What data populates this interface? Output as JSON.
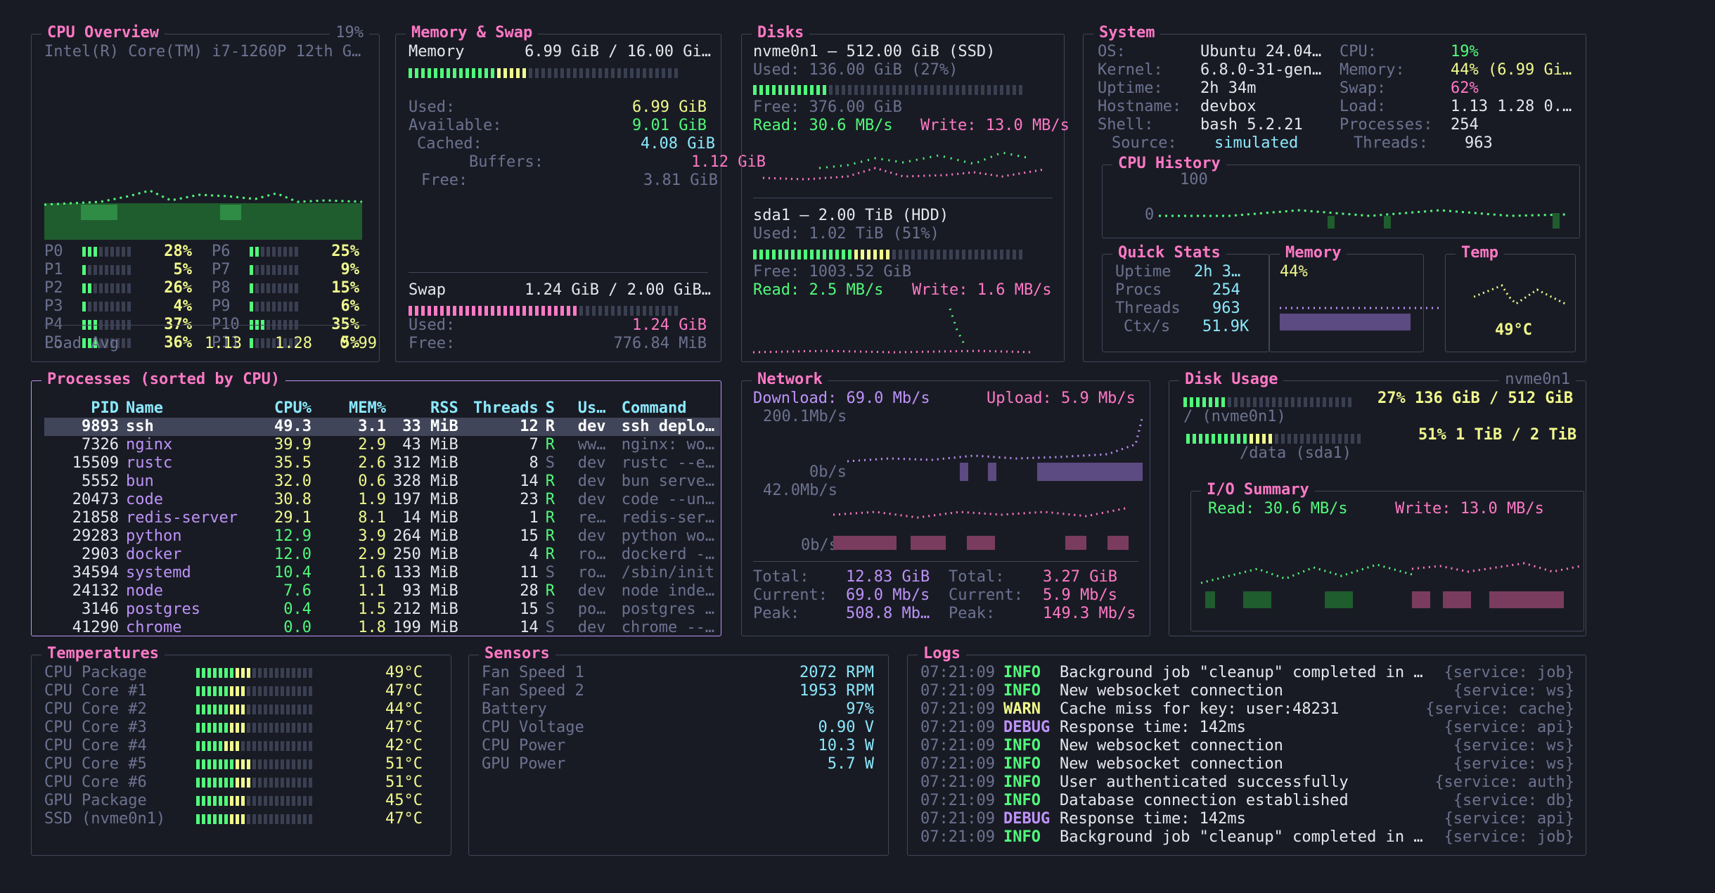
{
  "colors": {
    "bg": "#191b24",
    "border": "#414559",
    "title": "#ff79c6",
    "green": "#50fa7b",
    "pink": "#ff79c6",
    "yellow": "#f1fa8c",
    "cyan": "#8be9fd",
    "purple": "#bd93f9"
  },
  "cpu": {
    "title": "CPU Overview",
    "percent": "19%",
    "model": "Intel(R) Core(TM) i7-1260P 12th G…",
    "cores": [
      {
        "label": "P0",
        "value": "28%",
        "level": 0.28
      },
      {
        "label": "P6",
        "value": "25%",
        "level": 0.25
      },
      {
        "label": "P1",
        "value": "5%",
        "level": 0.05
      },
      {
        "label": "P7",
        "value": "9%",
        "level": 0.09
      },
      {
        "label": "P2",
        "value": "26%",
        "level": 0.26
      },
      {
        "label": "P8",
        "value": "15%",
        "level": 0.15
      },
      {
        "label": "P3",
        "value": "4%",
        "level": 0.04
      },
      {
        "label": "P9",
        "value": "6%",
        "level": 0.06
      },
      {
        "label": "P4",
        "value": "37%",
        "level": 0.37
      },
      {
        "label": "P10",
        "value": "35%",
        "level": 0.35
      },
      {
        "label": "P5",
        "value": "36%",
        "level": 0.36
      },
      {
        "label": "P11",
        "value": "5%",
        "level": 0.05
      }
    ],
    "load_label": "Load Avg",
    "load1": "1.13",
    "load5": "1.28",
    "load15": "0.99"
  },
  "memory": {
    "title": "Memory & Swap",
    "mem_label": "Memory",
    "mem_value": "6.99 GiB / 16.00 Gi…",
    "mem_level": 0.44,
    "used_label": "Used:",
    "used": "6.99 GiB",
    "avail_label": "Available:",
    "avail": "9.01 GiB",
    "cached_label": "Cached:",
    "cached": "4.08 GiB",
    "buffers_label": "Buffers:",
    "buffers": "1.12 GiB",
    "free_label": "Free:",
    "free": "3.81 GiB",
    "swap_label": "Swap",
    "swap_value": "1.24 GiB / 2.00 GiB…",
    "swap_level": 0.62,
    "swap_used_label": "Used:",
    "swap_used": "1.24 GiB",
    "swap_free_label": "Free:",
    "swap_free": "776.84 MiB"
  },
  "disks": {
    "title": "Disks",
    "d1": {
      "name": "nvme0n1 — 512.00 GiB (SSD)",
      "used": "Used: 136.00 GiB (27%)",
      "level": 0.27,
      "free": "Free: 376.00 GiB",
      "read": "Read: 30.6 MB/s",
      "write": "Write: 13.0 MB/s"
    },
    "d2": {
      "name": "sda1 — 2.00 TiB (HDD)",
      "used": "Used: 1.02 TiB (51%)",
      "level": 0.51,
      "free": "Free: 1003.52 GiB",
      "read": "Read: 2.5 MB/s",
      "write": "Write: 1.6 MB/s"
    }
  },
  "system": {
    "title": "System",
    "os_label": "OS:",
    "os": "Ubuntu 24.04…",
    "kernel_label": "Kernel:",
    "kernel": "6.8.0-31-gen…",
    "uptime_label": "Uptime:",
    "uptime": "2h 34m",
    "host_label": "Hostname:",
    "host": "devbox",
    "shell_label": "Shell:",
    "shell": "bash 5.2.21",
    "source_label": "Source:",
    "source": "simulated",
    "cpu_label": "CPU:",
    "cpu": "19%",
    "mem_label": "Memory:",
    "mem": "44% (6.99 Gi…",
    "swap_label": "Swap:",
    "swap": "62%",
    "load_label": "Load:",
    "load": "1.13 1.28 0.…",
    "procs_label": "Processes:",
    "procs": "254",
    "threads_label": "Threads:",
    "threads": "963",
    "history_title": "CPU History",
    "hist_max": "100",
    "hist_min": "0",
    "qs_title": "Quick Stats",
    "qs_uptime_label": "Uptime",
    "qs_uptime": "2h 3…",
    "qs_procs_label": "Procs",
    "qs_procs": "254",
    "qs_threads_label": "Threads",
    "qs_threads": "963",
    "qs_ctx_label": "Ctx/s",
    "qs_ctx": "51.9K",
    "memmini_title": "Memory",
    "memmini_value": "44%",
    "temp_title": "Temp",
    "temp_value": "49°C"
  },
  "processes": {
    "title": "Processes (sorted by CPU)",
    "headers": [
      "PID",
      "Name",
      "CPU%",
      "MEM%",
      "RSS",
      "Threads",
      "S",
      "Us…",
      "Command"
    ],
    "rows": [
      [
        "9893",
        "ssh",
        "49.3",
        "3.1",
        "33 MiB",
        "12",
        "R",
        "dev",
        "ssh deplo…"
      ],
      [
        "7326",
        "nginx",
        "39.9",
        "2.9",
        "43 MiB",
        "7",
        "R",
        "ww…",
        "nginx: wo…"
      ],
      [
        "15509",
        "rustc",
        "35.5",
        "2.6",
        "312 MiB",
        "8",
        "S",
        "dev",
        "rustc --e…"
      ],
      [
        "5552",
        "bun",
        "32.0",
        "0.6",
        "328 MiB",
        "14",
        "R",
        "dev",
        "bun serve…"
      ],
      [
        "20473",
        "code",
        "30.8",
        "1.9",
        "197 MiB",
        "23",
        "R",
        "dev",
        "code --un…"
      ],
      [
        "21858",
        "redis-server",
        "29.1",
        "8.1",
        "14 MiB",
        "1",
        "R",
        "re…",
        "redis-ser…"
      ],
      [
        "29283",
        "python",
        "12.9",
        "3.9",
        "264 MiB",
        "15",
        "R",
        "dev",
        "python wo…"
      ],
      [
        "2903",
        "docker",
        "12.0",
        "2.9",
        "250 MiB",
        "4",
        "R",
        "ro…",
        "dockerd -…"
      ],
      [
        "34594",
        "systemd",
        "10.4",
        "1.6",
        "133 MiB",
        "11",
        "S",
        "ro…",
        "/sbin/init"
      ],
      [
        "24132",
        "node",
        "7.6",
        "1.1",
        "93 MiB",
        "28",
        "R",
        "dev",
        "node inde…"
      ],
      [
        "3146",
        "postgres",
        "0.4",
        "1.5",
        "212 MiB",
        "15",
        "S",
        "po…",
        "postgres …"
      ],
      [
        "41290",
        "chrome",
        "0.0",
        "1.8",
        "199 MiB",
        "14",
        "S",
        "dev",
        "chrome --…"
      ]
    ]
  },
  "network": {
    "title": "Network",
    "download": "Download: 69.0 Mb/s",
    "upload": "Upload: 5.9 Mb/s",
    "dl_max": "200.1Mb/s",
    "dl_min": "0b/s",
    "ul_max": "42.0Mb/s",
    "ul_min": "0b/s",
    "total_label": "Total:",
    "dl_total": "12.83 GiB",
    "ul_total": "3.27 GiB",
    "current_label": "Current:",
    "dl_current": "69.0 Mb/s",
    "ul_current": "5.9 Mb/s",
    "peak_label": "Peak:",
    "dl_peak": "508.8 Mb…",
    "ul_peak": "149.3 Mb/s"
  },
  "disk_usage": {
    "title": "Disk Usage",
    "device": "nvme0n1",
    "d1_text": "27% 136 GiB / 512 GiB",
    "d1_level": 0.27,
    "d1_mount": "/ (nvme0n1)",
    "d2_text": "51% 1 TiB / 2 TiB",
    "d2_level": 0.51,
    "d2_mount": "/data (sda1)",
    "io_title": "I/O Summary",
    "io_read": "Read: 30.6 MB/s",
    "io_write": "Write: 13.0 MB/s"
  },
  "temperatures": {
    "title": "Temperatures",
    "rows": [
      {
        "label": "CPU Package",
        "value": "49°C",
        "level": 0.49
      },
      {
        "label": "CPU Core #1",
        "value": "47°C",
        "level": 0.47
      },
      {
        "label": "CPU Core #2",
        "value": "44°C",
        "level": 0.44
      },
      {
        "label": "CPU Core #3",
        "value": "47°C",
        "level": 0.47
      },
      {
        "label": "CPU Core #4",
        "value": "42°C",
        "level": 0.42
      },
      {
        "label": "CPU Core #5",
        "value": "51°C",
        "level": 0.51
      },
      {
        "label": "CPU Core #6",
        "value": "51°C",
        "level": 0.51
      },
      {
        "label": "GPU Package",
        "value": "45°C",
        "level": 0.45
      },
      {
        "label": "SSD (nvme0n1)",
        "value": "47°C",
        "level": 0.47
      }
    ]
  },
  "sensors": {
    "title": "Sensors",
    "rows": [
      {
        "label": "Fan Speed 1",
        "value": "2072 RPM"
      },
      {
        "label": "Fan Speed 2",
        "value": "1953 RPM"
      },
      {
        "label": "Battery",
        "value": "97%"
      },
      {
        "label": "CPU Voltage",
        "value": "0.90 V"
      },
      {
        "label": "CPU Power",
        "value": "10.3 W"
      },
      {
        "label": "GPU Power",
        "value": "5.7 W"
      }
    ]
  },
  "logs": {
    "title": "Logs",
    "rows": [
      {
        "time": "07:21:09",
        "level": "INFO",
        "msg": "Background job \"cleanup\" completed in …",
        "svc": "{service: job}"
      },
      {
        "time": "07:21:09",
        "level": "INFO",
        "msg": "New websocket connection",
        "svc": "{service: ws}"
      },
      {
        "time": "07:21:09",
        "level": "WARN",
        "msg": "Cache miss for key: user:48231",
        "svc": "{service: cache}"
      },
      {
        "time": "07:21:09",
        "level": "DEBUG",
        "msg": "Response time: 142ms",
        "svc": "{service: api}"
      },
      {
        "time": "07:21:09",
        "level": "INFO",
        "msg": "New websocket connection",
        "svc": "{service: ws}"
      },
      {
        "time": "07:21:09",
        "level": "INFO",
        "msg": "New websocket connection",
        "svc": "{service: ws}"
      },
      {
        "time": "07:21:09",
        "level": "INFO",
        "msg": "User authenticated successfully",
        "svc": "{service: auth}"
      },
      {
        "time": "07:21:09",
        "level": "INFO",
        "msg": "Database connection established",
        "svc": "{service: db}"
      },
      {
        "time": "07:21:09",
        "level": "DEBUG",
        "msg": "Response time: 142ms",
        "svc": "{service: api}"
      },
      {
        "time": "07:21:09",
        "level": "INFO",
        "msg": "Background job \"cleanup\" completed in …",
        "svc": "{service: job}"
      }
    ]
  }
}
